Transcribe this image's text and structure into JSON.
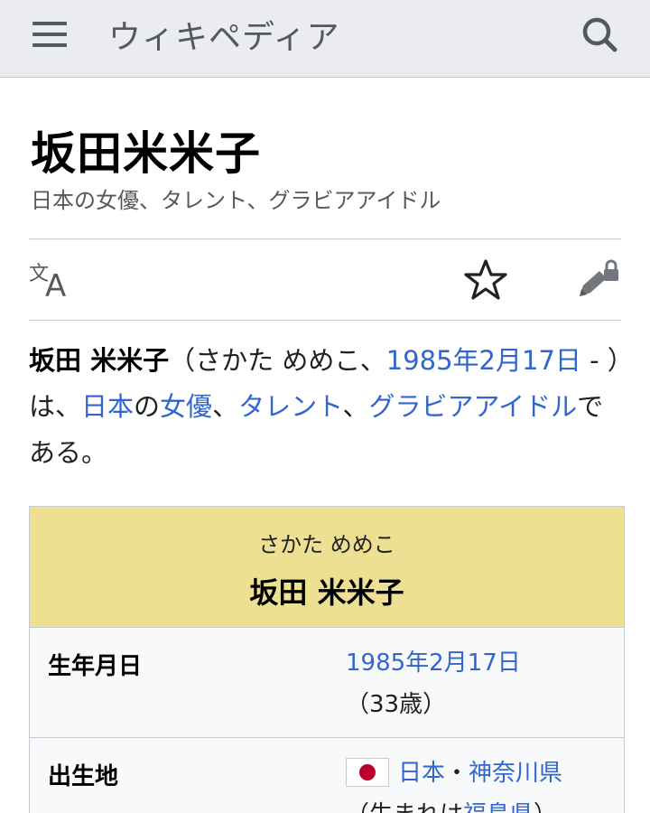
{
  "header": {
    "wordmark": "ウィキペディア",
    "menu_icon": "hamburger-menu-icon",
    "search_icon": "search-icon"
  },
  "article": {
    "title": "坂田米米子",
    "description": "日本の女優、タレント、グラビアアイドル"
  },
  "actions": {
    "language_icon": "language-translate-icon",
    "watch_icon": "star-icon",
    "edit_icon": "edit-locked-icon"
  },
  "lead": {
    "name": "坂田 米米子",
    "reading_open": "（さかた めめこ、",
    "birth_date_link": "1985年2月17日",
    "reading_close": " - ）は、",
    "link_japan": "日本",
    "text_no": "の",
    "link_actress": "女優",
    "sep1": "、",
    "link_talent": "タレント",
    "sep2": "、",
    "link_gravure": "グラビアアイドル",
    "ending": "である。"
  },
  "infobox": {
    "ruby": "さかた めめこ",
    "name": "坂田 米米子",
    "header_color": "#ede092",
    "rows": [
      {
        "label": "生年月日",
        "value_link": "1985年2月17日",
        "value_text": "（33歳）"
      },
      {
        "label": "出生地",
        "flag": "japan-flag-icon",
        "value_link1": "日本",
        "value_sep": "・",
        "value_link2": "神奈川県",
        "value_text": "（生まれは",
        "value_link3": "福島県",
        "value_text2": "）"
      }
    ]
  },
  "colors": {
    "link": "#3366cc",
    "header_bg": "#eaecf0",
    "muted_text": "#54595d"
  }
}
